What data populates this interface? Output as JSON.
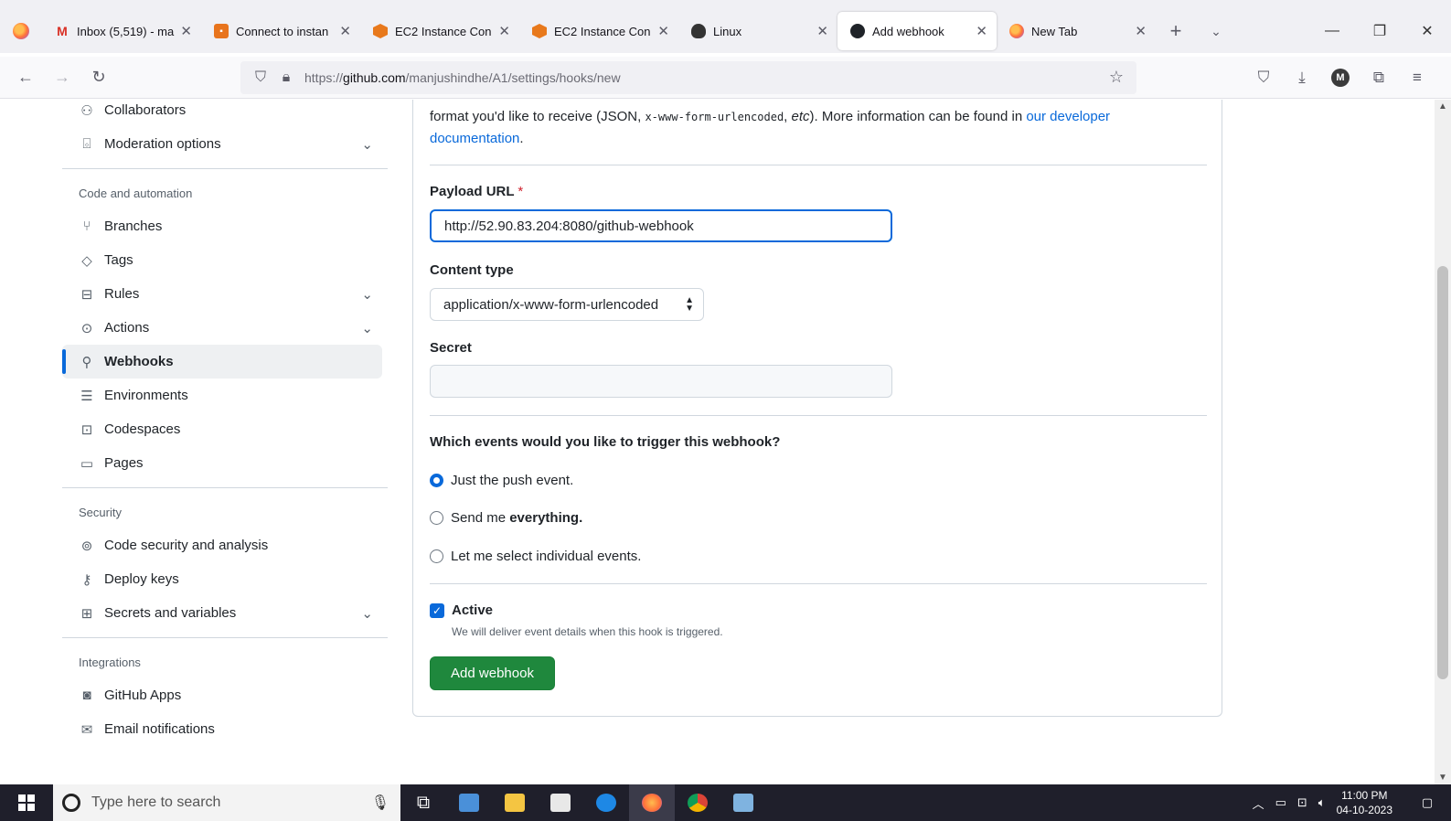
{
  "browser": {
    "tabs": [
      {
        "title": "Inbox (5,519) - ma",
        "favicon": "gmail-icon"
      },
      {
        "title": "Connect to instan",
        "favicon": "aws-icon"
      },
      {
        "title": "EC2 Instance Con",
        "favicon": "aws-cube-icon"
      },
      {
        "title": "EC2 Instance Con",
        "favicon": "aws-cube-icon"
      },
      {
        "title": "Linux",
        "favicon": "linux-icon"
      },
      {
        "title": "Add webhook",
        "favicon": "github-icon",
        "active": true
      },
      {
        "title": "New Tab",
        "favicon": "firefox-icon"
      }
    ],
    "url_prefix": "https://",
    "url_domain": "github.com",
    "url_path": "/manjushindhe/A1/settings/hooks/new",
    "account_initial": "M"
  },
  "sidebar": {
    "items_top": [
      {
        "label": "Collaborators",
        "icon": "people-icon"
      },
      {
        "label": "Moderation options",
        "icon": "report-icon",
        "chevron": true
      }
    ],
    "section_code": "Code and automation",
    "items_code": [
      {
        "label": "Branches",
        "icon": "git-branch-icon"
      },
      {
        "label": "Tags",
        "icon": "tag-icon"
      },
      {
        "label": "Rules",
        "icon": "repo-push-icon",
        "chevron": true
      },
      {
        "label": "Actions",
        "icon": "play-icon",
        "chevron": true
      },
      {
        "label": "Webhooks",
        "icon": "webhook-icon",
        "active": true
      },
      {
        "label": "Environments",
        "icon": "server-icon"
      },
      {
        "label": "Codespaces",
        "icon": "codespaces-icon"
      },
      {
        "label": "Pages",
        "icon": "browser-icon"
      }
    ],
    "section_security": "Security",
    "items_security": [
      {
        "label": "Code security and analysis",
        "icon": "codescan-icon"
      },
      {
        "label": "Deploy keys",
        "icon": "key-icon"
      },
      {
        "label": "Secrets and variables",
        "icon": "key-asterisk-icon",
        "chevron": true
      }
    ],
    "section_integrations": "Integrations",
    "items_integrations": [
      {
        "label": "GitHub Apps",
        "icon": "hubot-icon"
      },
      {
        "label": "Email notifications",
        "icon": "mail-icon"
      }
    ]
  },
  "form": {
    "intro_text_a": "format you'd like to receive (JSON, ",
    "intro_code": "x-www-form-urlencoded",
    "intro_text_b": ", ",
    "intro_em": "etc",
    "intro_text_c": "). More information can be found in ",
    "intro_link": "our developer documentation",
    "intro_end": ".",
    "payload_label": "Payload URL",
    "required_mark": "*",
    "payload_value": "http://52.90.83.204:8080/github-webhook",
    "content_type_label": "Content type",
    "content_type_value": "application/x-www-form-urlencoded",
    "secret_label": "Secret",
    "secret_value": "",
    "events_question": "Which events would you like to trigger this webhook?",
    "event_push": "Just the push event.",
    "event_everything_a": "Send me ",
    "event_everything_b": "everything.",
    "event_select": "Let me select individual events.",
    "active_label": "Active",
    "active_note": "We will deliver event details when this hook is triggered.",
    "submit_label": "Add webhook"
  },
  "taskbar": {
    "search_placeholder": "Type here to search",
    "time": "11:00 PM",
    "date": "04-10-2023"
  }
}
